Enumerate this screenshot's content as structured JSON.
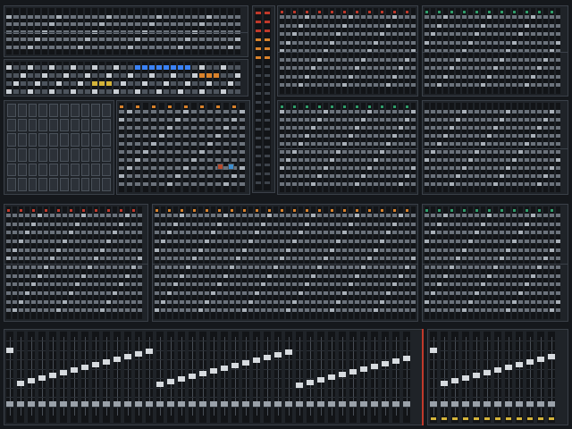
{
  "colors": {
    "background": "#15181c",
    "panel": "#1f2328",
    "panel_border": "#3a4048",
    "strip": "#121417",
    "fader_cap": "#d7dbdf",
    "knob": "#6b727b",
    "accent_blue": "#3b82f6",
    "accent_red": "#c0392b",
    "accent_green": "#2f9e6a",
    "accent_orange": "#d9822b",
    "accent_yellow": "#d4b43a"
  },
  "sections": [
    {
      "id": "top-left-bank",
      "led": null,
      "strip_color": "strip"
    },
    {
      "id": "top-left-buttons",
      "led": "accent_blue",
      "strip_color": "strip"
    },
    {
      "id": "top-meter-column",
      "led": null,
      "strip_color": "strip"
    },
    {
      "id": "top-center-bank",
      "led": "accent_red",
      "strip_color": "strip"
    },
    {
      "id": "top-right-bank",
      "led": "accent_green",
      "strip_color": "strip"
    },
    {
      "id": "mid-left-grid",
      "led": null,
      "strip_color": "strip"
    },
    {
      "id": "mid-center-controls",
      "led": "accent_orange",
      "strip_color": "strip"
    },
    {
      "id": "mid-center-bank",
      "led": "accent_green",
      "strip_color": "strip"
    },
    {
      "id": "mid-right-bank",
      "led": null,
      "strip_color": "strip"
    },
    {
      "id": "lower-left-bank",
      "led": "accent_red",
      "strip_color": "strip"
    },
    {
      "id": "lower-center-bank",
      "led": "accent_orange",
      "strip_color": "strip"
    },
    {
      "id": "lower-right-bank",
      "led": "accent_green",
      "strip_color": "strip"
    },
    {
      "id": "fader-bank",
      "led": null,
      "strip_color": "strip"
    },
    {
      "id": "fader-right-bank",
      "led": "accent_yellow",
      "strip_color": "strip"
    }
  ],
  "selected_strip_marker": "accent_red"
}
